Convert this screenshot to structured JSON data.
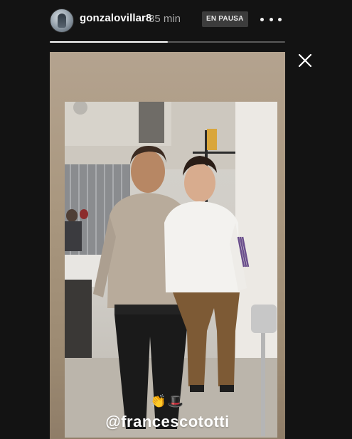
{
  "header": {
    "username": "gonzalovillar8",
    "time_ago": "35 min",
    "paused_label": "EN PAUSA",
    "avatar_icon": "user-avatar",
    "more_icon": "more-horizontal-icon"
  },
  "progress": {
    "fraction": 0.5
  },
  "close_icon": "close-icon",
  "story": {
    "emoji": "👏🎩",
    "mention": "@francescototti"
  },
  "colors": {
    "background": "#131313",
    "card": "#a9977f",
    "badge": "#3c3c3c"
  }
}
